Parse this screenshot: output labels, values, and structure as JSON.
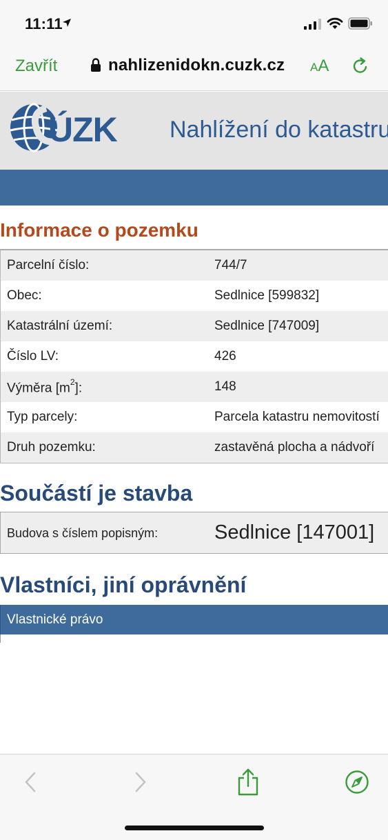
{
  "status_bar": {
    "time": "11:11",
    "icons": [
      "location-arrow-icon",
      "signal-bars-icon",
      "wifi-icon",
      "battery-icon"
    ]
  },
  "browser": {
    "close_label": "Zavřít",
    "url": "nahlizenidokn.cuzk.cz",
    "text_size_small": "A",
    "text_size_big": "A",
    "accent_color": "#3a9b3a",
    "icons": [
      "lock-icon",
      "reload-icon"
    ]
  },
  "site": {
    "logo_text": "ÚZK",
    "title": "Nahlížení do katastru nemovitostí",
    "brand_color": "#2d5a92",
    "nav_color": "#3e6b9b"
  },
  "parcel_info": {
    "heading": "Informace o pozemku",
    "heading_color": "#b34a1e",
    "rows": [
      {
        "label": "Parcelní číslo:",
        "value": "744/7"
      },
      {
        "label": "Obec:",
        "value": "Sedlnice [599832]"
      },
      {
        "label": "Katastrální území:",
        "value": "Sedlnice [747009]"
      },
      {
        "label": "Číslo LV:",
        "value": "426"
      },
      {
        "label": "Výměra [m",
        "label_sup": "2",
        "label_end": "]:",
        "value": "148"
      },
      {
        "label": "Typ parcely:",
        "value": "Parcela katastru nemovitostí"
      },
      {
        "label": "Druh pozemku:",
        "value": "zastavěná plocha a nádvoří"
      }
    ]
  },
  "building": {
    "heading": "Součástí je stavba",
    "label": "Budova s číslem popisným:",
    "value": "Sedlnice [147001]"
  },
  "owners": {
    "heading": "Vlastníci, jiní oprávnění",
    "table_header": "Vlastnické právo"
  },
  "bottom_toolbar": {
    "icons": [
      "back-arrow-icon",
      "forward-arrow-icon",
      "share-icon",
      "compass-icon"
    ]
  }
}
